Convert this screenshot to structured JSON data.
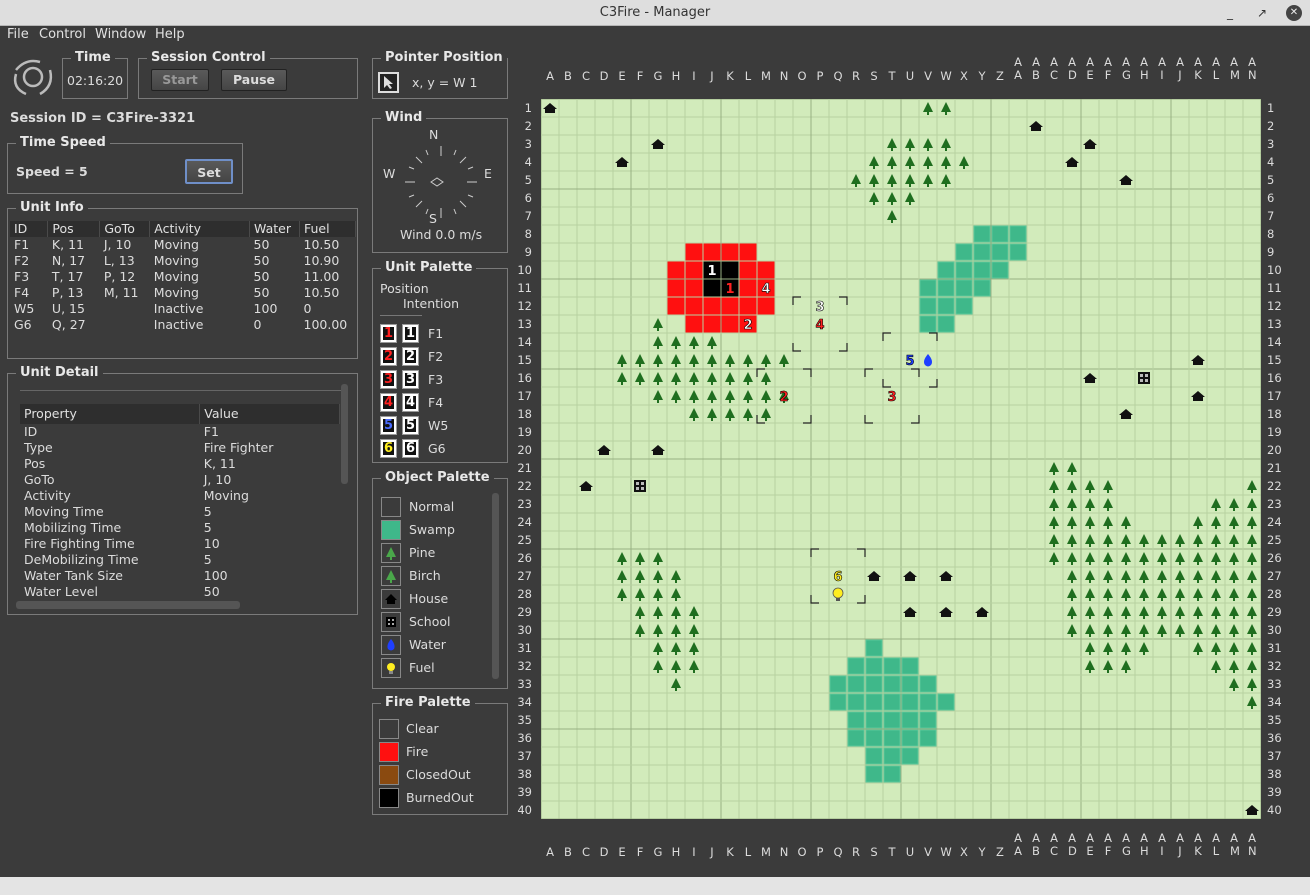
{
  "window": {
    "title": "C3Fire - Manager",
    "minimize": "_",
    "maximize": "↗",
    "close": "✕"
  },
  "menu": [
    "File",
    "Control",
    "Window",
    "Help"
  ],
  "time": {
    "title": "Time",
    "value": "02:16:20"
  },
  "session_control": {
    "title": "Session Control",
    "start": "Start",
    "pause": "Pause"
  },
  "session_id": "Session ID = C3Fire-3321",
  "time_speed": {
    "title": "Time Speed",
    "label": "Speed = 5",
    "set": "Set"
  },
  "unit_info": {
    "title": "Unit Info",
    "columns": [
      "ID",
      "Pos",
      "GoTo",
      "Activity",
      "Water",
      "Fuel"
    ],
    "rows": [
      [
        "F1",
        "K, 11",
        "J, 10",
        "Moving",
        "50",
        "10.50"
      ],
      [
        "F2",
        "N, 17",
        "L, 13",
        "Moving",
        "50",
        "10.90"
      ],
      [
        "F3",
        "T, 17",
        "P, 12",
        "Moving",
        "50",
        "11.00"
      ],
      [
        "F4",
        "P, 13",
        "M, 11",
        "Moving",
        "50",
        "10.50"
      ],
      [
        "W5",
        "U, 15",
        "",
        "Inactive",
        "100",
        "0"
      ],
      [
        "G6",
        "Q, 27",
        "",
        "Inactive",
        "0",
        "100.00"
      ]
    ]
  },
  "unit_detail": {
    "title": "Unit Detail",
    "columns": [
      "Property",
      "Value"
    ],
    "rows": [
      [
        "ID",
        "F1"
      ],
      [
        "Type",
        "Fire Fighter"
      ],
      [
        "Pos",
        "K, 11"
      ],
      [
        "GoTo",
        "J, 10"
      ],
      [
        "Activity",
        "Moving"
      ],
      [
        "Moving Time",
        "5"
      ],
      [
        "Mobilizing Time",
        "5"
      ],
      [
        "Fire Fighting Time",
        "10"
      ],
      [
        "DeMobilizing Time",
        "5"
      ],
      [
        "Water Tank Size",
        "100"
      ],
      [
        "Water Level",
        "50"
      ]
    ]
  },
  "pointer_position": {
    "title": "Pointer Position",
    "text": "x, y =   W 1"
  },
  "wind": {
    "title": "Wind",
    "n": "N",
    "s": "S",
    "e": "E",
    "w": "W",
    "speed": "Wind 0.0 m/s"
  },
  "unit_palette": {
    "title": "Unit Palette",
    "position": "Position",
    "intention": "Intention",
    "units": [
      {
        "num": "1",
        "label": "F1",
        "color": "#ff2020"
      },
      {
        "num": "2",
        "label": "F2",
        "color": "#ff2020"
      },
      {
        "num": "3",
        "label": "F3",
        "color": "#ff2020"
      },
      {
        "num": "4",
        "label": "F4",
        "color": "#ff2020"
      },
      {
        "num": "5",
        "label": "W5",
        "color": "#4a6cff"
      },
      {
        "num": "6",
        "label": "G6",
        "color": "#ffee20"
      }
    ]
  },
  "object_palette": {
    "title": "Object Palette",
    "items": [
      {
        "label": "Normal",
        "color": "#3b3b3b",
        "icon": "normal-swatch"
      },
      {
        "label": "Swamp",
        "color": "#3fb88a",
        "icon": "swamp-swatch"
      },
      {
        "label": "Pine",
        "color": "#2f7d2f",
        "icon": "pine-icon"
      },
      {
        "label": "Birch",
        "color": "#2f7d2f",
        "icon": "birch-icon"
      },
      {
        "label": "House",
        "color": "#111111",
        "icon": "house-icon"
      },
      {
        "label": "School",
        "color": "#111111",
        "icon": "school-icon"
      },
      {
        "label": "Water",
        "color": "#1f3fff",
        "icon": "water-icon"
      },
      {
        "label": "Fuel",
        "color": "#ffee20",
        "icon": "fuel-icon"
      }
    ]
  },
  "fire_palette": {
    "title": "Fire Palette",
    "items": [
      {
        "label": "Clear",
        "color": "#3b3b3b"
      },
      {
        "label": "Fire",
        "color": "#ff1010"
      },
      {
        "label": "ClosedOut",
        "color": "#8a4a10"
      },
      {
        "label": "BurnedOut",
        "color": "#000000"
      }
    ]
  },
  "map": {
    "columns": [
      "A",
      "B",
      "C",
      "D",
      "E",
      "F",
      "G",
      "H",
      "I",
      "J",
      "K",
      "L",
      "M",
      "N",
      "O",
      "P",
      "Q",
      "R",
      "S",
      "T",
      "U",
      "V",
      "W",
      "X",
      "Y",
      "Z",
      "AA",
      "AB",
      "AC",
      "AD",
      "AE",
      "AF",
      "AG",
      "AH",
      "AI",
      "AJ",
      "AK",
      "AL",
      "AM",
      "AN"
    ],
    "rows": [
      "1",
      "2",
      "3",
      "4",
      "5",
      "6",
      "7",
      "8",
      "9",
      "10",
      "11",
      "12",
      "13",
      "14",
      "15",
      "16",
      "17",
      "18",
      "19",
      "20",
      "21",
      "22",
      "23",
      "24",
      "25",
      "26",
      "27",
      "28",
      "29",
      "30",
      "31",
      "32",
      "33",
      "34",
      "35",
      "36",
      "37",
      "38",
      "39",
      "40"
    ],
    "colors": {
      "ground": "#d2ebbb",
      "grid": "#b8d2a0",
      "major": "#98b083",
      "swamp": "#3fb88a",
      "fire": "#ff1010",
      "burned": "#000000",
      "tree": "#1f6e1f",
      "house": "#111111"
    },
    "fire": [
      [
        8,
        9
      ],
      [
        9,
        9
      ],
      [
        10,
        9
      ],
      [
        11,
        9
      ],
      [
        7,
        10
      ],
      [
        8,
        10
      ],
      [
        11,
        10
      ],
      [
        12,
        10
      ],
      [
        7,
        11
      ],
      [
        8,
        11
      ],
      [
        12,
        10
      ],
      [
        7,
        12
      ],
      [
        8,
        12
      ],
      [
        9,
        12
      ],
      [
        10,
        12
      ],
      [
        11,
        12
      ],
      [
        12,
        12
      ],
      [
        8,
        13
      ],
      [
        9,
        13
      ],
      [
        10,
        13
      ],
      [
        11,
        13
      ],
      [
        12,
        11
      ],
      [
        11,
        11
      ]
    ],
    "burned": [
      [
        9,
        10
      ],
      [
        10,
        10
      ],
      [
        9,
        11
      ],
      [
        10,
        11
      ]
    ],
    "swamp": [
      [
        24,
        8
      ],
      [
        25,
        8
      ],
      [
        26,
        8
      ],
      [
        23,
        9
      ],
      [
        24,
        9
      ],
      [
        25,
        9
      ],
      [
        26,
        9
      ],
      [
        22,
        10
      ],
      [
        23,
        10
      ],
      [
        24,
        10
      ],
      [
        25,
        10
      ],
      [
        21,
        11
      ],
      [
        22,
        11
      ],
      [
        23,
        11
      ],
      [
        24,
        11
      ],
      [
        21,
        12
      ],
      [
        22,
        12
      ],
      [
        23,
        12
      ],
      [
        21,
        13
      ],
      [
        22,
        13
      ],
      [
        18,
        31
      ],
      [
        17,
        32
      ],
      [
        18,
        32
      ],
      [
        19,
        32
      ],
      [
        20,
        32
      ],
      [
        16,
        33
      ],
      [
        17,
        33
      ],
      [
        18,
        33
      ],
      [
        19,
        33
      ],
      [
        20,
        33
      ],
      [
        21,
        33
      ],
      [
        16,
        34
      ],
      [
        17,
        34
      ],
      [
        18,
        34
      ],
      [
        19,
        34
      ],
      [
        20,
        34
      ],
      [
        21,
        34
      ],
      [
        22,
        34
      ],
      [
        17,
        35
      ],
      [
        18,
        35
      ],
      [
        19,
        35
      ],
      [
        20,
        35
      ],
      [
        21,
        35
      ],
      [
        17,
        36
      ],
      [
        18,
        36
      ],
      [
        19,
        36
      ],
      [
        20,
        36
      ],
      [
        21,
        36
      ],
      [
        18,
        37
      ],
      [
        19,
        37
      ],
      [
        20,
        37
      ],
      [
        18,
        38
      ],
      [
        19,
        38
      ]
    ],
    "trees": [
      [
        21,
        1
      ],
      [
        22,
        1
      ],
      [
        19,
        3
      ],
      [
        20,
        3
      ],
      [
        21,
        3
      ],
      [
        22,
        3
      ],
      [
        18,
        4
      ],
      [
        19,
        4
      ],
      [
        20,
        4
      ],
      [
        21,
        4
      ],
      [
        22,
        4
      ],
      [
        23,
        4
      ],
      [
        17,
        5
      ],
      [
        18,
        5
      ],
      [
        19,
        5
      ],
      [
        20,
        5
      ],
      [
        21,
        5
      ],
      [
        22,
        5
      ],
      [
        18,
        6
      ],
      [
        19,
        6
      ],
      [
        20,
        6
      ],
      [
        19,
        7
      ],
      [
        6,
        13
      ],
      [
        6,
        14
      ],
      [
        7,
        14
      ],
      [
        8,
        14
      ],
      [
        9,
        14
      ],
      [
        4,
        15
      ],
      [
        5,
        15
      ],
      [
        6,
        15
      ],
      [
        7,
        15
      ],
      [
        8,
        15
      ],
      [
        9,
        15
      ],
      [
        10,
        15
      ],
      [
        11,
        15
      ],
      [
        12,
        15
      ],
      [
        13,
        15
      ],
      [
        4,
        16
      ],
      [
        5,
        16
      ],
      [
        6,
        16
      ],
      [
        7,
        16
      ],
      [
        8,
        16
      ],
      [
        9,
        16
      ],
      [
        10,
        16
      ],
      [
        11,
        16
      ],
      [
        12,
        16
      ],
      [
        6,
        17
      ],
      [
        7,
        17
      ],
      [
        8,
        17
      ],
      [
        9,
        17
      ],
      [
        10,
        17
      ],
      [
        11,
        17
      ],
      [
        12,
        17
      ],
      [
        13,
        17
      ],
      [
        8,
        18
      ],
      [
        9,
        18
      ],
      [
        10,
        18
      ],
      [
        11,
        18
      ],
      [
        12,
        18
      ],
      [
        28,
        21
      ],
      [
        29,
        21
      ],
      [
        28,
        22
      ],
      [
        29,
        22
      ],
      [
        30,
        22
      ],
      [
        31,
        22
      ],
      [
        39,
        22
      ],
      [
        28,
        23
      ],
      [
        29,
        23
      ],
      [
        30,
        23
      ],
      [
        31,
        23
      ],
      [
        37,
        23
      ],
      [
        38,
        23
      ],
      [
        39,
        23
      ],
      [
        28,
        24
      ],
      [
        29,
        24
      ],
      [
        30,
        24
      ],
      [
        31,
        24
      ],
      [
        32,
        24
      ],
      [
        36,
        24
      ],
      [
        37,
        24
      ],
      [
        38,
        24
      ],
      [
        39,
        24
      ],
      [
        28,
        25
      ],
      [
        29,
        25
      ],
      [
        30,
        25
      ],
      [
        31,
        25
      ],
      [
        32,
        25
      ],
      [
        33,
        25
      ],
      [
        34,
        25
      ],
      [
        35,
        25
      ],
      [
        36,
        25
      ],
      [
        37,
        25
      ],
      [
        38,
        25
      ],
      [
        39,
        25
      ],
      [
        4,
        26
      ],
      [
        5,
        26
      ],
      [
        6,
        26
      ],
      [
        28,
        26
      ],
      [
        29,
        26
      ],
      [
        30,
        26
      ],
      [
        31,
        26
      ],
      [
        32,
        26
      ],
      [
        33,
        26
      ],
      [
        34,
        26
      ],
      [
        35,
        26
      ],
      [
        36,
        26
      ],
      [
        37,
        26
      ],
      [
        38,
        26
      ],
      [
        39,
        26
      ],
      [
        4,
        27
      ],
      [
        5,
        27
      ],
      [
        6,
        27
      ],
      [
        7,
        27
      ],
      [
        29,
        27
      ],
      [
        30,
        27
      ],
      [
        31,
        27
      ],
      [
        32,
        27
      ],
      [
        33,
        27
      ],
      [
        34,
        27
      ],
      [
        35,
        27
      ],
      [
        36,
        27
      ],
      [
        37,
        27
      ],
      [
        38,
        27
      ],
      [
        39,
        27
      ],
      [
        4,
        28
      ],
      [
        5,
        28
      ],
      [
        6,
        28
      ],
      [
        7,
        28
      ],
      [
        29,
        28
      ],
      [
        30,
        28
      ],
      [
        31,
        28
      ],
      [
        32,
        28
      ],
      [
        33,
        28
      ],
      [
        34,
        28
      ],
      [
        35,
        28
      ],
      [
        36,
        28
      ],
      [
        37,
        28
      ],
      [
        38,
        28
      ],
      [
        39,
        28
      ],
      [
        5,
        29
      ],
      [
        6,
        29
      ],
      [
        7,
        29
      ],
      [
        8,
        29
      ],
      [
        29,
        29
      ],
      [
        30,
        29
      ],
      [
        31,
        29
      ],
      [
        32,
        29
      ],
      [
        33,
        29
      ],
      [
        34,
        29
      ],
      [
        35,
        29
      ],
      [
        36,
        29
      ],
      [
        37,
        29
      ],
      [
        38,
        29
      ],
      [
        39,
        29
      ],
      [
        5,
        30
      ],
      [
        6,
        30
      ],
      [
        7,
        30
      ],
      [
        8,
        30
      ],
      [
        29,
        30
      ],
      [
        30,
        30
      ],
      [
        31,
        30
      ],
      [
        32,
        30
      ],
      [
        33,
        30
      ],
      [
        34,
        30
      ],
      [
        35,
        30
      ],
      [
        36,
        30
      ],
      [
        37,
        30
      ],
      [
        38,
        30
      ],
      [
        39,
        30
      ],
      [
        6,
        31
      ],
      [
        7,
        31
      ],
      [
        8,
        31
      ],
      [
        30,
        31
      ],
      [
        31,
        31
      ],
      [
        32,
        31
      ],
      [
        33,
        31
      ],
      [
        36,
        31
      ],
      [
        37,
        31
      ],
      [
        38,
        31
      ],
      [
        39,
        31
      ],
      [
        6,
        32
      ],
      [
        7,
        32
      ],
      [
        8,
        32
      ],
      [
        30,
        32
      ],
      [
        31,
        32
      ],
      [
        32,
        32
      ],
      [
        37,
        32
      ],
      [
        38,
        32
      ],
      [
        39,
        32
      ],
      [
        7,
        33
      ],
      [
        38,
        33
      ],
      [
        39,
        33
      ],
      [
        39,
        34
      ]
    ],
    "houses": [
      [
        0,
        1
      ],
      [
        27,
        2
      ],
      [
        6,
        3
      ],
      [
        30,
        3
      ],
      [
        4,
        4
      ],
      [
        29,
        4
      ],
      [
        32,
        5
      ],
      [
        36,
        15
      ],
      [
        30,
        16
      ],
      [
        36,
        17
      ],
      [
        32,
        18
      ],
      [
        3,
        20
      ],
      [
        6,
        20
      ],
      [
        2,
        22
      ],
      [
        18,
        27
      ],
      [
        20,
        27
      ],
      [
        22,
        27
      ],
      [
        20,
        29
      ],
      [
        22,
        29
      ],
      [
        24,
        29
      ],
      [
        39,
        40
      ]
    ],
    "schools": [
      [
        33,
        16
      ],
      [
        5,
        22
      ]
    ],
    "unit_markers": [
      {
        "num": "1",
        "c": 9,
        "r": 10,
        "color": "#ffffff",
        "bg": "#000000"
      },
      {
        "num": "1",
        "c": 10,
        "r": 11,
        "color": "#ff2020",
        "bg": "#000000"
      },
      {
        "num": "4",
        "c": 12,
        "r": 11,
        "color": "#ffffff",
        "bg": ""
      },
      {
        "num": "2",
        "c": 11,
        "r": 13,
        "color": "#ffffff",
        "bg": ""
      },
      {
        "num": "3",
        "c": 15,
        "r": 12,
        "color": "#ffffff",
        "bg": ""
      },
      {
        "num": "4",
        "c": 15,
        "r": 13,
        "color": "#ff2020",
        "bg": ""
      },
      {
        "num": "5",
        "c": 20,
        "r": 15,
        "color": "#1f3fff",
        "bg": ""
      },
      {
        "num": "2",
        "c": 13,
        "r": 17,
        "color": "#ff2020",
        "bg": ""
      },
      {
        "num": "3",
        "c": 19,
        "r": 17,
        "color": "#ff2020",
        "bg": ""
      },
      {
        "num": "6",
        "c": 16,
        "r": 27,
        "color": "#ffee20",
        "bg": ""
      }
    ],
    "water_icon": [
      21,
      15
    ],
    "fuel_icon": [
      16,
      28
    ],
    "brackets": [
      [
        14,
        12,
        3,
        3
      ],
      [
        19,
        14,
        3,
        3
      ],
      [
        12,
        16,
        3,
        3
      ],
      [
        18,
        16,
        3,
        3
      ],
      [
        15,
        26,
        3,
        3
      ]
    ]
  }
}
